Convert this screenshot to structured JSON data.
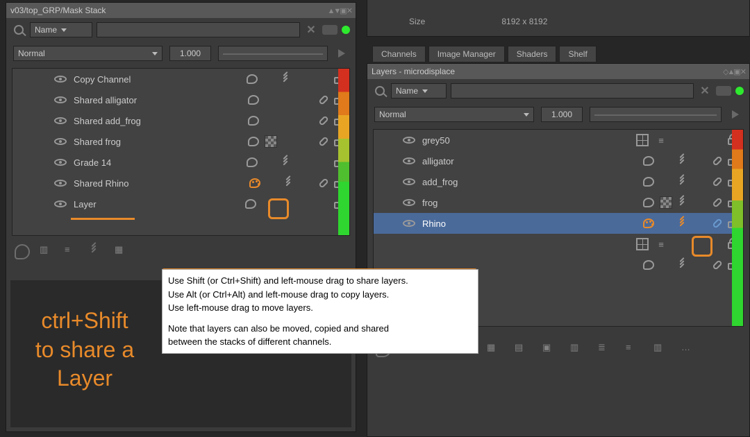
{
  "left_panel": {
    "title": "v03/top_GRP/Mask Stack",
    "filter_label": "Name",
    "blend_mode": "Normal",
    "opacity": "1.000",
    "layers": [
      {
        "name": "Copy Channel",
        "palette": "normal",
        "brush": true,
        "link": false,
        "lock": "unlock",
        "checker": false
      },
      {
        "name": "Shared alligator",
        "palette": "normal",
        "brush": false,
        "link": true,
        "lock": "unlock",
        "checker": false
      },
      {
        "name": "Shared add_frog",
        "palette": "normal",
        "brush": false,
        "link": true,
        "lock": "unlock",
        "checker": false
      },
      {
        "name": "Shared frog",
        "palette": "normal",
        "brush": false,
        "link": true,
        "lock": "unlock",
        "checker": true
      },
      {
        "name": "Grade 14",
        "palette": "normal",
        "brush": true,
        "link": false,
        "lock": "unlock",
        "checker": false
      },
      {
        "name": "Shared Rhino",
        "palette": "orange",
        "brush": true,
        "link": true,
        "lock": "unlock",
        "checker": false,
        "link_hl": true
      },
      {
        "name": "Layer",
        "palette": "normal",
        "brush": false,
        "link": false,
        "lock": "unlock",
        "checker": false
      }
    ],
    "colorbar": [
      "#d3301f",
      "#e07a1a",
      "#e8a524",
      "#6fbf2a",
      "#2fd62f",
      "#28e528"
    ]
  },
  "right_panel": {
    "info_block": {
      "label_size": "Size",
      "value_size": "8192 x 8192"
    },
    "tabs": [
      "Channels",
      "Image Manager",
      "Shaders",
      "Shelf"
    ],
    "layers_title": "Layers - microdisplace",
    "filter_label": "Name",
    "blend_mode": "Normal",
    "opacity": "1.000",
    "layers": [
      {
        "name": "grey50",
        "selected": false,
        "grid": true,
        "bars": true,
        "brush": false,
        "link": false,
        "lock": "lock"
      },
      {
        "name": "alligator",
        "selected": false,
        "grid": false,
        "bars": false,
        "brush": true,
        "link": true,
        "lock": "unlock"
      },
      {
        "name": "add_frog",
        "selected": false,
        "grid": false,
        "bars": false,
        "brush": true,
        "link": true,
        "lock": "unlock"
      },
      {
        "name": "frog",
        "selected": false,
        "grid": false,
        "bars": false,
        "brush": true,
        "link": true,
        "lock": "unlock",
        "checker": true
      },
      {
        "name": "Rhino",
        "selected": true,
        "grid": false,
        "bars": false,
        "brush": true,
        "link": true,
        "lock": "unlock",
        "palette": "orange",
        "brush_orange": true,
        "link_hl": true
      },
      {
        "name": "",
        "selected": false,
        "grid": true,
        "bars": true,
        "brush": false,
        "link": false,
        "lock": "lock"
      },
      {
        "name": "",
        "selected": false,
        "grid": false,
        "bars": false,
        "brush": true,
        "link": true,
        "lock": "unlock"
      }
    ],
    "colorbar": [
      "#d3301f",
      "#e07a1a",
      "#e8a524",
      "#6fbf2a",
      "#2fd62f",
      "#2fd62f",
      "#28e528"
    ]
  },
  "tooltip": {
    "l1": "Use Shift (or Ctrl+Shift) and left-mouse drag to share layers.",
    "l2": "Use Alt (or Ctrl+Alt) and left-mouse drag to copy layers.",
    "l3": "Use left-mouse drag to move layers.",
    "l4": "Note that layers can also be moved, copied and shared",
    "l5": "between the stacks of different channels."
  },
  "annotation": "ctrl+Shift\nto share a\nLayer"
}
